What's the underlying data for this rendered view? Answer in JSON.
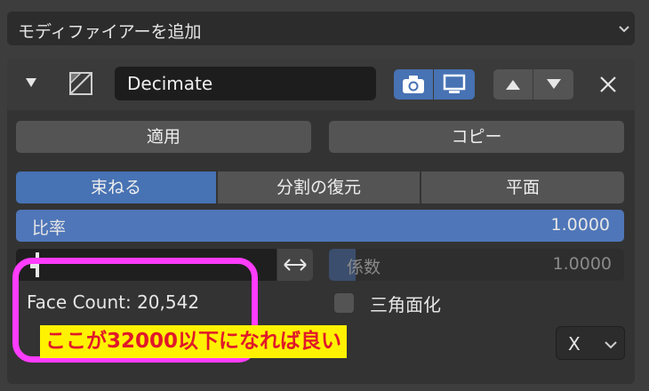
{
  "add_modifier": {
    "label": "モディファイアーを追加"
  },
  "modifier": {
    "name": "Decimate",
    "buttons": {
      "apply": "適用",
      "copy": "コピー"
    },
    "tabs": [
      {
        "label": "束ねる",
        "active": true
      },
      {
        "label": "分割の復元",
        "active": false
      },
      {
        "label": "平面",
        "active": false
      }
    ],
    "ratio": {
      "label": "比率",
      "value": "1.0000"
    },
    "coefficient": {
      "label": "係数",
      "value": "1.0000"
    },
    "face_count": "Face Count: 20,542",
    "triangulate": {
      "label": "三角面化",
      "checked": false
    },
    "axis": {
      "value": "X"
    }
  },
  "annotation": {
    "text": "ここが32000以下になれば良い"
  },
  "colors": {
    "accent_blue": "#4772b3",
    "highlight_pink": "#ff3cff",
    "note_bg": "#fff200",
    "note_text": "#e0182a"
  },
  "icons": [
    "chevron-down-icon",
    "collapse-triangle-icon",
    "decimate-modifier-icon",
    "camera-icon",
    "monitor-icon",
    "arrow-up-icon",
    "arrow-down-icon",
    "close-icon",
    "symmetry-icon",
    "swap-arrows-icon"
  ]
}
